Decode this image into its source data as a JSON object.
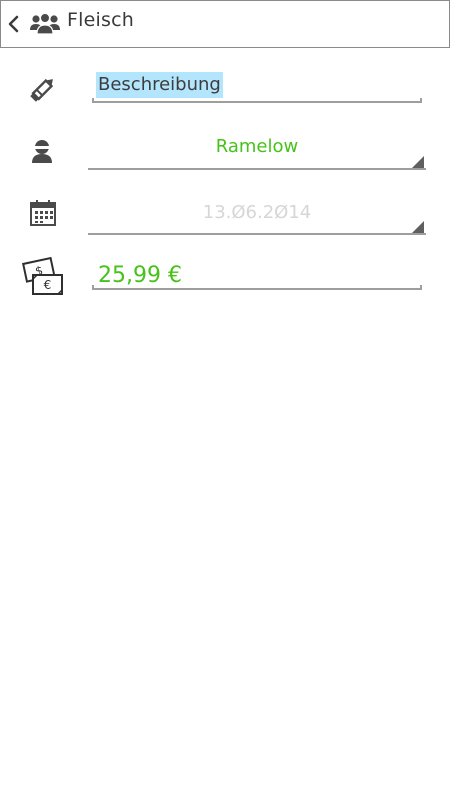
{
  "header": {
    "title": "Fleisch",
    "back_icon": "chevron-left-icon",
    "category_icon": "group-icon"
  },
  "form": {
    "description": {
      "icon": "pencil-icon",
      "value": "Beschreibung"
    },
    "person": {
      "icon": "person-icon",
      "value": "Ramelow",
      "color": "#46c21a"
    },
    "date": {
      "icon": "calendar-icon",
      "value": "13.Ø6.2Ø14",
      "color": "#d6d6d6"
    },
    "amount": {
      "icon": "money-icon",
      "value": "25,99 €",
      "color": "#46c21a"
    }
  },
  "colors": {
    "highlight": "#b3e5fc",
    "underline": "#9e9e9e",
    "accent_green": "#46c21a"
  }
}
